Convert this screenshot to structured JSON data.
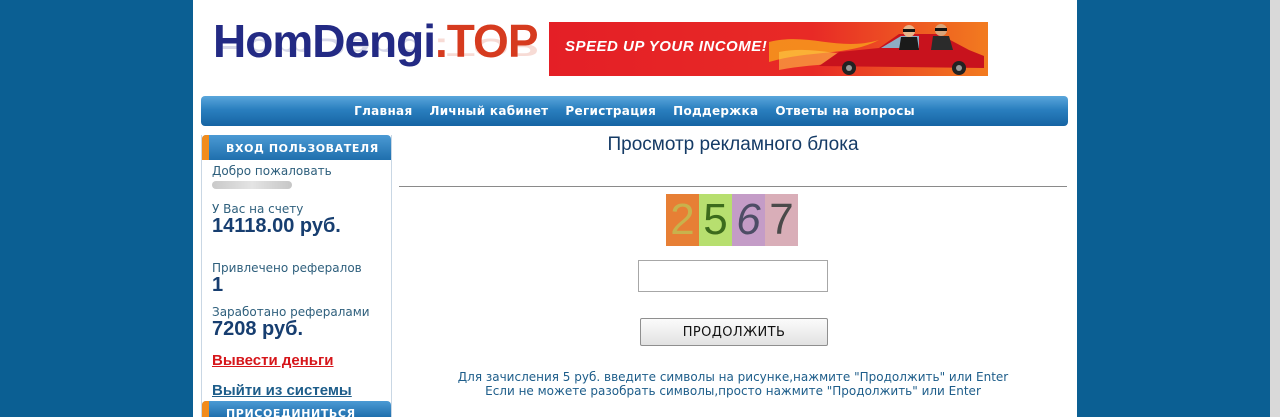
{
  "header": {
    "logo_main": "HomDengi",
    "logo_suffix": ".TOP",
    "banner_text": "SPEED UP YOUR INCOME!"
  },
  "nav": {
    "items": [
      "Главная",
      "Личный кабинет",
      "Регистрация",
      "Поддержка",
      "Ответы на вопросы"
    ]
  },
  "sidebar": {
    "login_title": "ВХОД ПОЛЬЗОВАТЕЛЯ",
    "welcome": "Добро пожаловать",
    "balance_label": "У Вас на счету",
    "balance_value": "14118.00 руб.",
    "referrals_label": "Привлечено рефералов",
    "referrals_value": "1",
    "earned_label": "Заработано рефералами",
    "earned_value": "7208 руб.",
    "withdraw_link": "Вывести деньги",
    "logout_link": "Выйти из системы",
    "join_title": "ПРИСОЕДИНИТЬСЯ"
  },
  "main": {
    "title": "Просмотр рекламного блока",
    "captcha_digits": [
      "2",
      "5",
      "6",
      "7"
    ],
    "input_value": "",
    "continue_button": "ПРОДОЛЖИТЬ",
    "instruction_line1": "Для зачисления 5 руб. введите символы на рисунке,нажмите \"Продолжить\" или Enter",
    "instruction_line2": "Если не можете разобрать символы,просто нажмите \"Продолжить\" или Enter"
  },
  "colors": {
    "background": "#0b5f93",
    "nav_blue": "#2a7fbf",
    "accent_orange": "#f28c1c",
    "link_red": "#d6161b",
    "text_blue": "#1d5d8a"
  }
}
